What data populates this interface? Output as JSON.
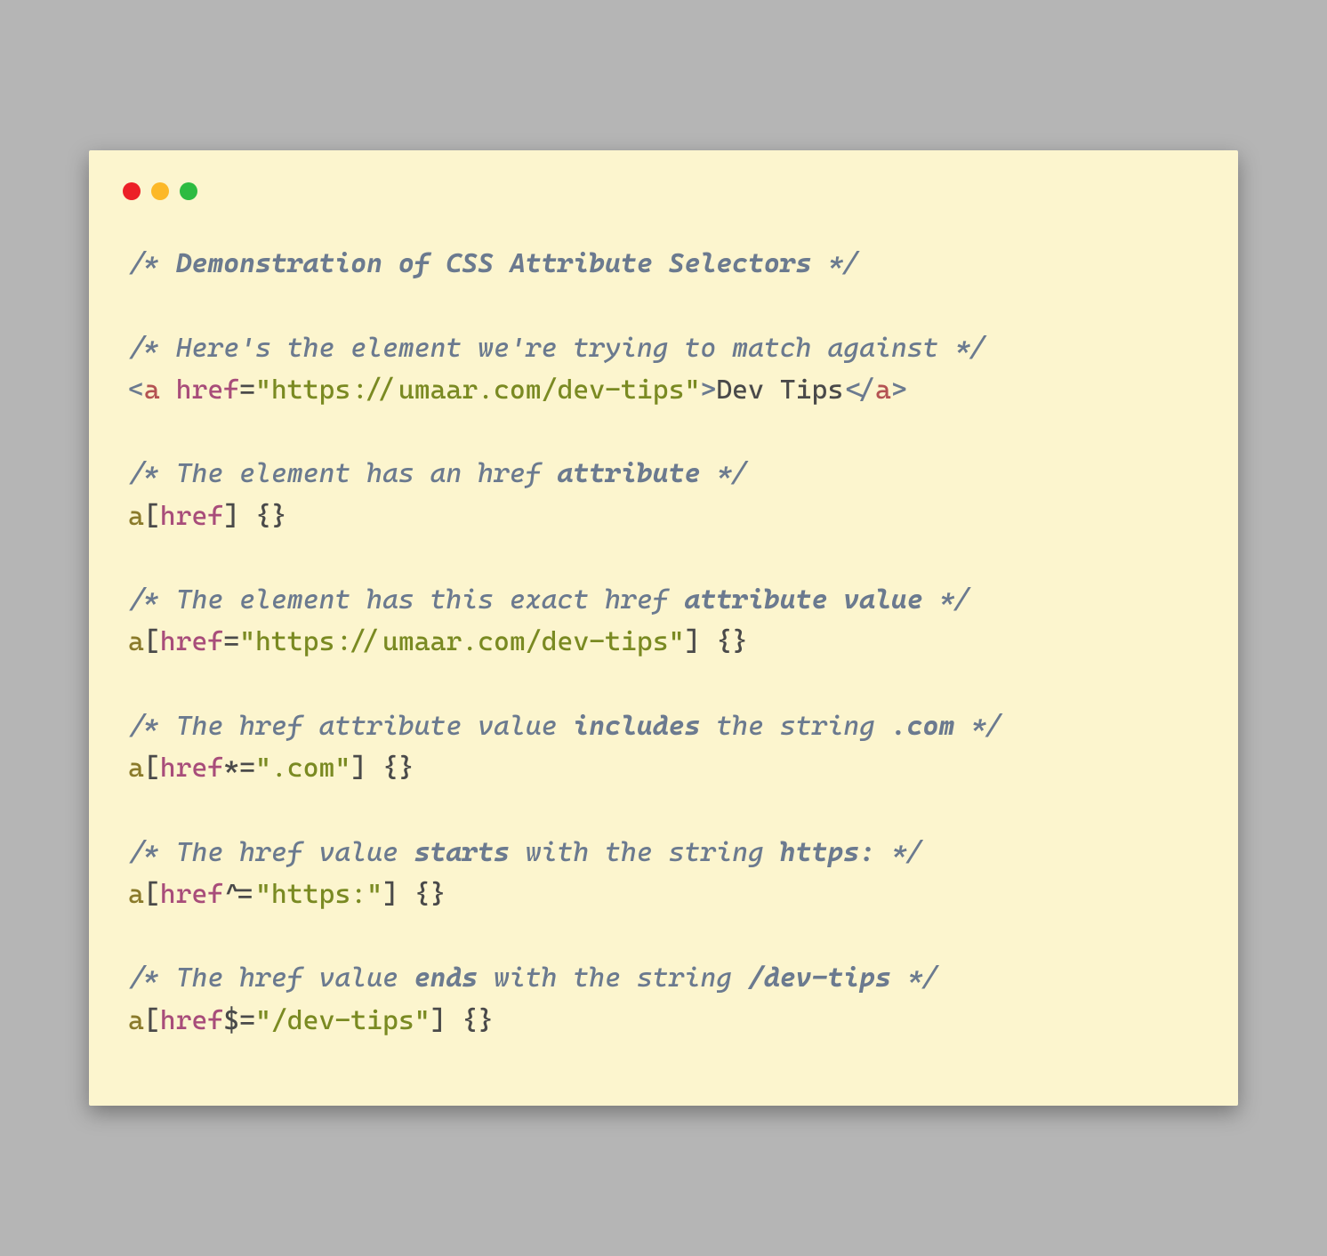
{
  "blocks": {
    "b0": {
      "comment": {
        "pre": "/* ",
        "bold": "Demonstration of CSS Attribute Selectors",
        "post": " */"
      }
    },
    "b1": {
      "comment": {
        "pre": "/* Here's the element we're trying to match against */",
        "bold": "",
        "post": ""
      },
      "html_example": {
        "open_lt": "<",
        "tag": "a",
        "space": " ",
        "attr": "href",
        "eq": "=",
        "q1": "\"",
        "url": "https://umaar.com/dev-tips",
        "q2": "\"",
        "gt": ">",
        "text": "Dev Tips",
        "close_lt": "</",
        "close_tag": "a",
        "close_gt": ">"
      }
    },
    "b2": {
      "comment": {
        "pre": "/* The element has an href ",
        "bold": "attribute",
        "post": " */"
      },
      "selector": {
        "el": "a",
        "lb": "[",
        "attr": "href",
        "op": "",
        "val_q1": "",
        "val": "",
        "val_q2": "",
        "rb": "]",
        "braces": " {}"
      }
    },
    "b3": {
      "comment": {
        "pre": "/* The element has this exact href ",
        "bold": "attribute value",
        "post": " */"
      },
      "selector": {
        "el": "a",
        "lb": "[",
        "attr": "href",
        "op": "=",
        "val_q1": "\"",
        "val": "https://umaar.com/dev-tips",
        "val_q2": "\"",
        "rb": "]",
        "braces": " {}"
      }
    },
    "b4": {
      "comment": {
        "pre": "/* The href attribute value ",
        "bold": "includes",
        "post": " the string ",
        "bold2": ".com",
        "post2": " */"
      },
      "selector": {
        "el": "a",
        "lb": "[",
        "attr": "href",
        "op": "*=",
        "val_q1": "\"",
        "val": ".com",
        "val_q2": "\"",
        "rb": "]",
        "braces": " {}"
      }
    },
    "b5": {
      "comment": {
        "pre": "/* The href value ",
        "bold": "starts",
        "post": " with the string ",
        "bold2": "https:",
        "post2": " */"
      },
      "selector": {
        "el": "a",
        "lb": "[",
        "attr": "href",
        "op": "^=",
        "val_q1": "\"",
        "val": "https:",
        "val_q2": "\"",
        "rb": "]",
        "braces": " {}"
      }
    },
    "b6": {
      "comment": {
        "pre": "/* The href value ",
        "bold": "ends",
        "post": " with the string ",
        "bold2": "/dev-tips",
        "post2": " */"
      },
      "selector": {
        "el": "a",
        "lb": "[",
        "attr": "href",
        "op": "$=",
        "val_q1": "\"",
        "val": "/dev-tips",
        "val_q2": "\"",
        "rb": "]",
        "braces": " {}"
      }
    }
  }
}
